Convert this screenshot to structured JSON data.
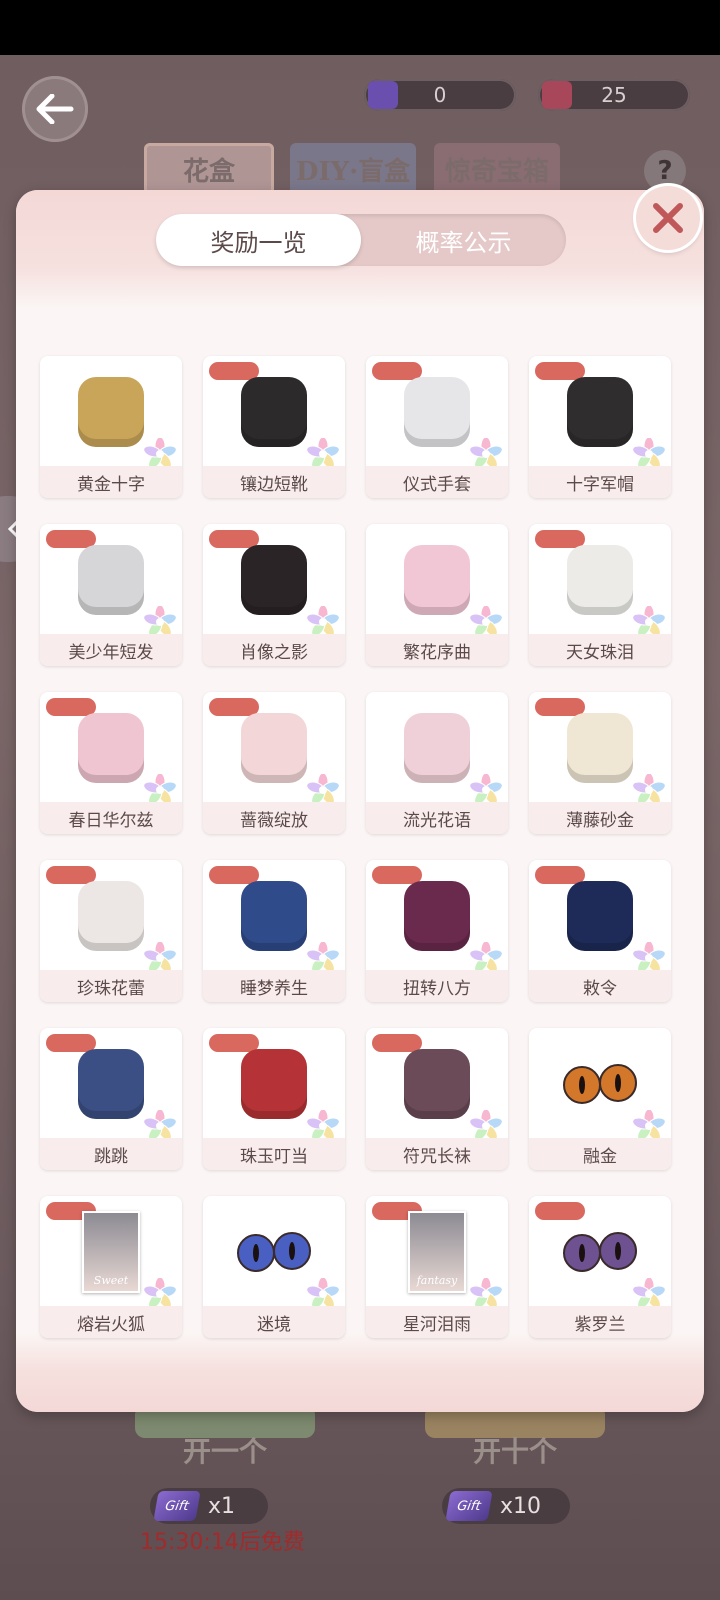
{
  "currencies": [
    {
      "value": "0",
      "icon": "purple-ticket-icon",
      "color": "#7b5fc4"
    },
    {
      "value": "25",
      "icon": "gem-cube-icon",
      "color": "#c9485a"
    }
  ],
  "top_tabs": [
    "花盒",
    "DIY·盲盒",
    "惊奇宝箱"
  ],
  "help_label": "?",
  "modal": {
    "tabs": {
      "active": "奖励一览",
      "inactive": "概率公示"
    }
  },
  "items": [
    {
      "label": "黄金十字",
      "badge": false,
      "icon": "gold-cross-earring-icon"
    },
    {
      "label": "镶边短靴",
      "badge": true,
      "icon": "boots-icon"
    },
    {
      "label": "仪式手套",
      "badge": true,
      "icon": "gloves-icon"
    },
    {
      "label": "十字军帽",
      "badge": true,
      "icon": "military-cap-icon"
    },
    {
      "label": "美少年短发",
      "badge": true,
      "icon": "short-hair-icon"
    },
    {
      "label": "肖像之影",
      "badge": true,
      "icon": "coat-icon"
    },
    {
      "label": "繁花序曲",
      "badge": false,
      "icon": "dress-icon"
    },
    {
      "label": "天女珠泪",
      "badge": true,
      "icon": "pearl-headband-icon"
    },
    {
      "label": "春日华尔兹",
      "badge": true,
      "icon": "pink-shoes-icon"
    },
    {
      "label": "蔷薇绽放",
      "badge": true,
      "icon": "lace-gloves-icon"
    },
    {
      "label": "流光花语",
      "badge": false,
      "icon": "fan-icon"
    },
    {
      "label": "薄藤砂金",
      "badge": true,
      "icon": "long-hair-icon"
    },
    {
      "label": "珍珠花蕾",
      "badge": true,
      "icon": "pearl-earrings-icon"
    },
    {
      "label": "睡梦养生",
      "badge": true,
      "icon": "blue-jacket-icon"
    },
    {
      "label": "扭转八方",
      "badge": true,
      "icon": "braided-hair-icon"
    },
    {
      "label": "敕令",
      "badge": true,
      "icon": "talisman-hat-icon"
    },
    {
      "label": "跳跳",
      "badge": true,
      "icon": "blue-boots-icon"
    },
    {
      "label": "珠玉叮当",
      "badge": true,
      "icon": "tassel-earrings-icon"
    },
    {
      "label": "符咒长袜",
      "badge": true,
      "icon": "stockings-icon"
    },
    {
      "label": "融金",
      "badge": false,
      "icon": "gold-eyes-icon"
    },
    {
      "label": "熔岩火狐",
      "badge": true,
      "icon": "portrait-makeup-icon",
      "portrait_text": "Sweet"
    },
    {
      "label": "迷境",
      "badge": false,
      "icon": "blue-eyes-icon"
    },
    {
      "label": "星河泪雨",
      "badge": true,
      "icon": "portrait-makeup-icon",
      "portrait_text": "fantasy"
    },
    {
      "label": "紫罗兰",
      "badge": true,
      "icon": "violet-eyes-icon"
    }
  ],
  "bottom": {
    "open_one": "开一个",
    "open_ten": "开十个",
    "count_one": "x1",
    "count_ten": "x10",
    "ticket_text": "Gift",
    "free_timer": "15:30:14后免费"
  }
}
